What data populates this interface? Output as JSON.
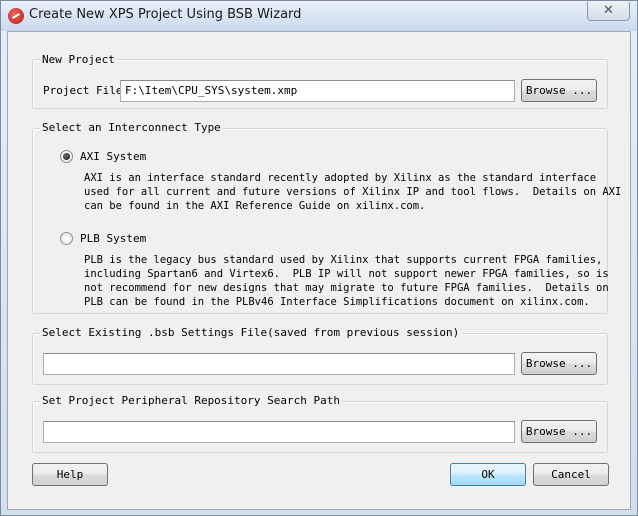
{
  "window": {
    "title": "Create New XPS Project Using BSB Wizard",
    "close_glyph": "✕"
  },
  "new_project": {
    "group_label": "New Project",
    "project_file_label": "Project File",
    "project_file_value": "F:\\Item\\CPU_SYS\\system.xmp",
    "browse_label": "Browse ..."
  },
  "interconnect": {
    "group_label": "Select an Interconnect Type",
    "axi": {
      "label": "AXI System",
      "checked": true,
      "desc": [
        "AXI is an interface standard recently adopted by Xilinx as the standard interface",
        "used for all current and future versions of Xilinx IP and tool flows.  Details on AXI",
        "can be found in the AXI Reference Guide on xilinx.com."
      ]
    },
    "plb": {
      "label": "PLB System",
      "checked": false,
      "desc": [
        "PLB is the legacy bus standard used by Xilinx that supports current FPGA families,",
        "including Spartan6 and Virtex6.  PLB IP will not support newer FPGA families, so is",
        "not recommend for new designs that may migrate to future FPGA families.  Details on",
        "PLB can be found in the PLBv46 Interface Simplifications document on xilinx.com."
      ]
    }
  },
  "bsb_settings": {
    "group_label": "Select Existing .bsb Settings File(saved from previous session)",
    "value": "",
    "browse_label": "Browse ..."
  },
  "repo_path": {
    "group_label": "Set Project Peripheral Repository Search Path",
    "value": "",
    "browse_label": "Browse ..."
  },
  "footer": {
    "help_label": "Help",
    "ok_label": "OK",
    "cancel_label": "Cancel"
  }
}
